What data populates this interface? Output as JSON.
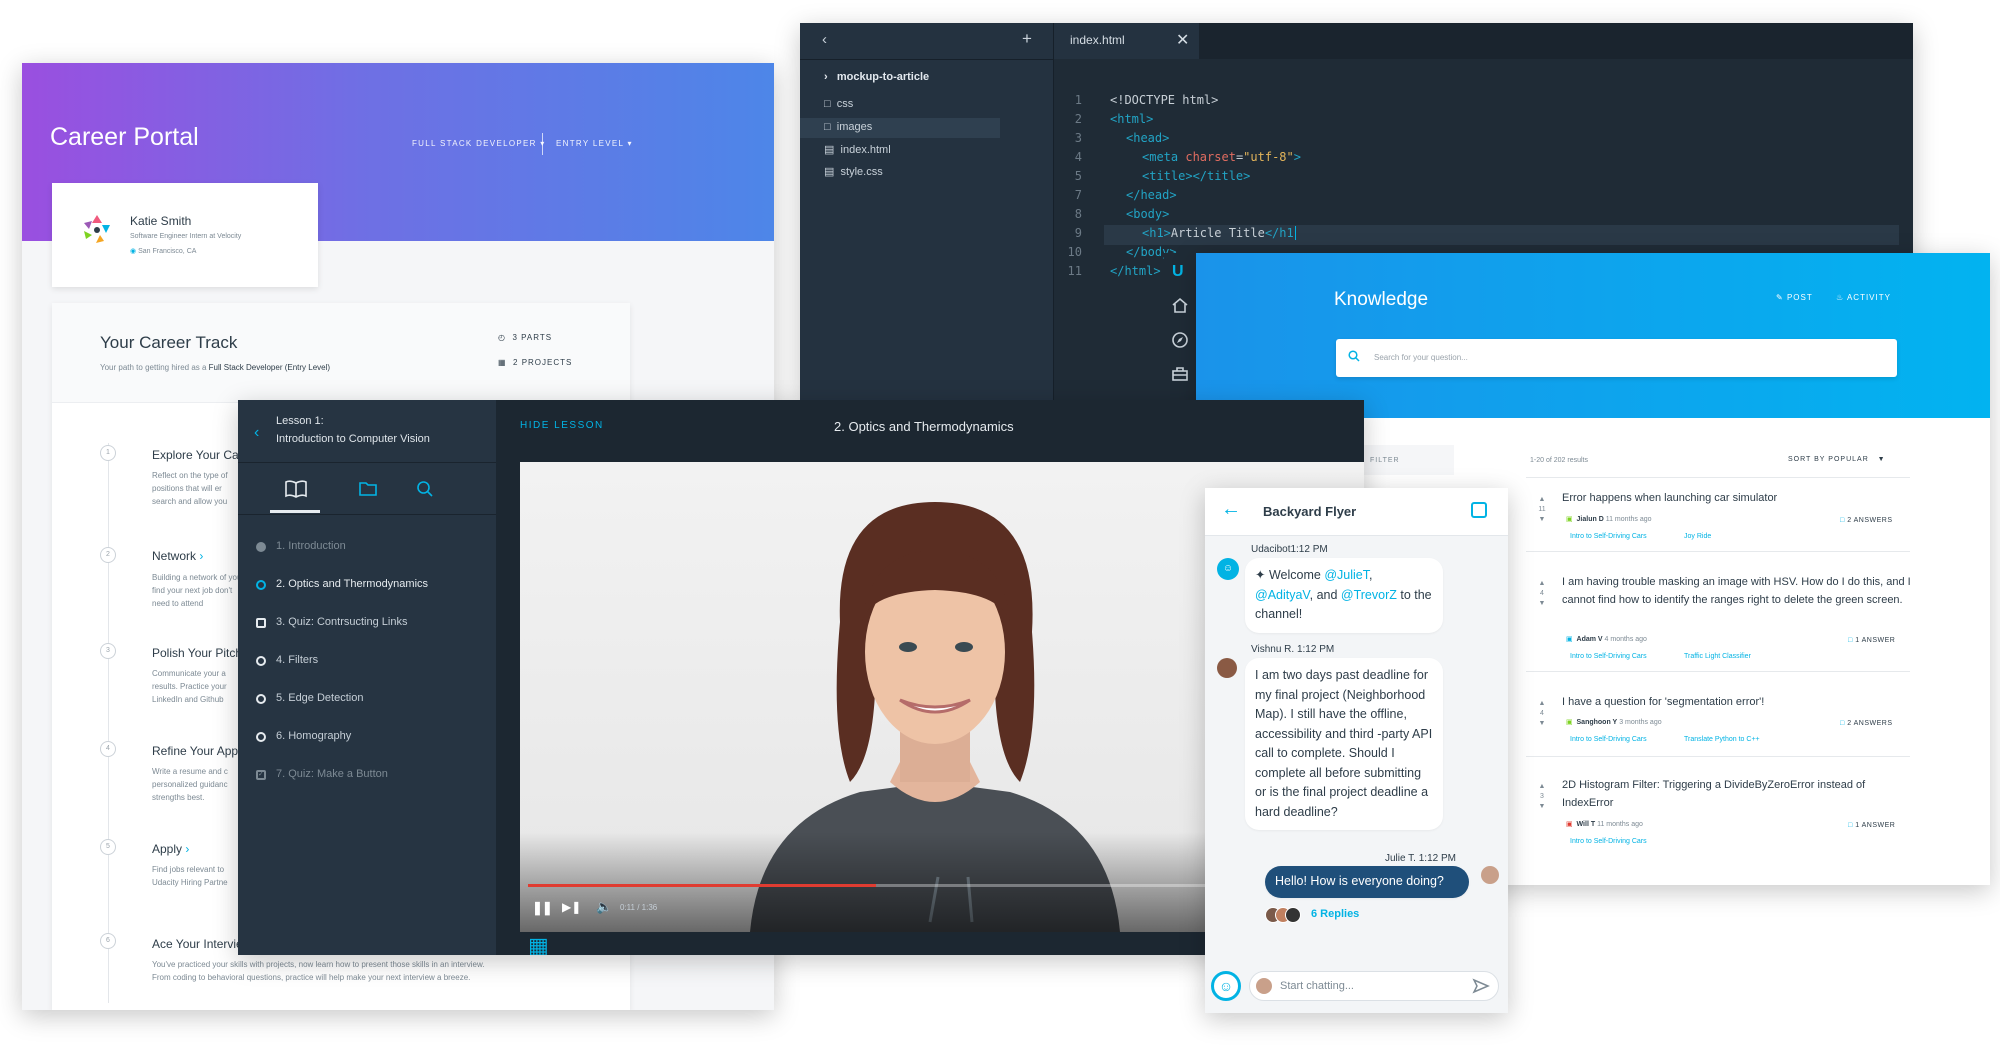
{
  "career": {
    "title": "Career Portal",
    "dropdown_role": "FULL STACK DEVELOPER",
    "dropdown_level": "ENTRY LEVEL",
    "profile": {
      "name": "Katie Smith",
      "role": "Software Engineer Intern at Velocity",
      "location": "San Francisco, CA"
    },
    "track": {
      "title": "Your Career Track",
      "subtitle_prefix": "Your path to getting hired as a ",
      "subtitle_bold": "Full Stack Developer (Entry Level)",
      "parts": "3 PARTS",
      "projects": "2 PROJECTS"
    },
    "steps": [
      {
        "num": "1",
        "title": "Explore Your Car",
        "desc": "Reflect on the type of positions that will er search and allow you"
      },
      {
        "num": "2",
        "title": "Network",
        "desc": "Building a network of you find your next job don't need to attend"
      },
      {
        "num": "3",
        "title": "Polish Your Pitch",
        "desc": "Communicate your a results. Practice your LinkedIn and Github"
      },
      {
        "num": "4",
        "title": "Refine Your Appl",
        "desc": "Write a resume and c personalized guidanc strengths best."
      },
      {
        "num": "5",
        "title": "Apply",
        "desc": "Find jobs relevant to Udacity Hiring Partne"
      },
      {
        "num": "6",
        "title": "Ace Your Intervie",
        "desc": "You've practiced your skills with projects, now learn how to present those skills in an interview. From coding to behavioral questions, practice will help make your next interview a breeze."
      }
    ]
  },
  "editor": {
    "project": "mockup-to-article",
    "files": [
      "css",
      "images",
      "index.html",
      "style.css"
    ],
    "tab": "index.html",
    "line_numbers": [
      "1",
      "2",
      "3",
      "4",
      "5",
      "7",
      "8",
      "9",
      "10",
      "11"
    ],
    "code": {
      "l1": "<!DOCTYPE html>",
      "l2": "<html>",
      "l3": "<head>",
      "l4a": "<meta ",
      "l4b": "charset",
      "l4c": "=",
      "l4d": "\"utf-8\"",
      "l4e": ">",
      "l5a": "<title>",
      "l5b": "</title>",
      "l7": "</head>",
      "l8": "<body>",
      "l9a": "<h1>",
      "l9b": "Article Title",
      "l9c": "</h1",
      "l10": "</body>",
      "l11": "</html>"
    }
  },
  "knowledge": {
    "title": "Knowledge",
    "post": "POST",
    "activity": "ACTIVITY",
    "search_placeholder": "Search for your question...",
    "filter": "FILTER",
    "results": "1-20 of 202 results",
    "sort": "SORT BY POPULAR",
    "questions": [
      {
        "votes": "11",
        "title": "Error happens when launching car simulator",
        "author": "Jialun D",
        "time": "11 months ago",
        "tags": [
          "Intro to Self-Driving Cars",
          "Joy Ride"
        ],
        "answers": "2 ANSWERS"
      },
      {
        "votes": "4",
        "title": "I am having trouble masking an image with HSV. How do I do this, and I cannot find how to identify the ranges right to delete the green screen.",
        "author": "Adam V",
        "time": "4 months ago",
        "tags": [
          "Intro to Self-Driving Cars",
          "Traffic Light Classifier"
        ],
        "answers": "1 ANSWER"
      },
      {
        "votes": "4",
        "title": "I have a question for 'segmentation error'!",
        "author": "Sanghoon Y",
        "time": "3 months ago",
        "tags": [
          "Intro to Self-Driving Cars",
          "Translate Python to C++"
        ],
        "answers": "2 ANSWERS"
      },
      {
        "votes": "3",
        "title": "2D Histogram Filter: Triggering a DivideByZeroError instead of IndexError",
        "author": "Will T",
        "time": "11 months ago",
        "tags": [
          "Intro to Self-Driving Cars"
        ],
        "answers": "1 ANSWER"
      }
    ]
  },
  "lesson": {
    "lesson_label": "Lesson 1:",
    "lesson_title": "Introduction to Computer Vision",
    "hide": "HIDE LESSON",
    "concept_title": "2. Optics and Thermodynamics",
    "items": [
      "1. Introduction",
      "2. Optics and Thermodynamics",
      "3. Quiz: Contrsucting Links",
      "4. Filters",
      "5. Edge Detection",
      "6. Homography",
      "7. Quiz: Make a Button"
    ],
    "time": "0:11 / 1:36",
    "progress": 0.42
  },
  "chat": {
    "channel": "Backyard Flyer",
    "msg1_author": "Udacibot",
    "msg1_time": "1:12 PM",
    "msg1_p1": " Welcome ",
    "msg1_m1": "@JulieT",
    "msg1_p2": ", ",
    "msg1_m2": "@AdityaV",
    "msg1_p3": ", and ",
    "msg1_m3": "@TrevorZ",
    "msg1_p4": " to the channel!",
    "msg2_author": "Vishnu R.",
    "msg2_time": "1:12 PM",
    "msg2": "I am two days past deadline for my final project (Neighborhood Map). I still have the offline, accessibility and third -party API call to complete. Should I complete all before submitting or is the final project deadline a hard deadline?",
    "msg3_author": "Julie T.",
    "msg3_time": "1:12 PM",
    "msg3": "Hello! How is everyone doing?",
    "replies": "6 Replies",
    "input_placeholder": "Start chatting..."
  },
  "colors": {
    "accent": "#02b3e4",
    "progress": "#e03c31",
    "career_gradient_start": "#9a4fe0",
    "career_gradient_end": "#4d86e8"
  }
}
